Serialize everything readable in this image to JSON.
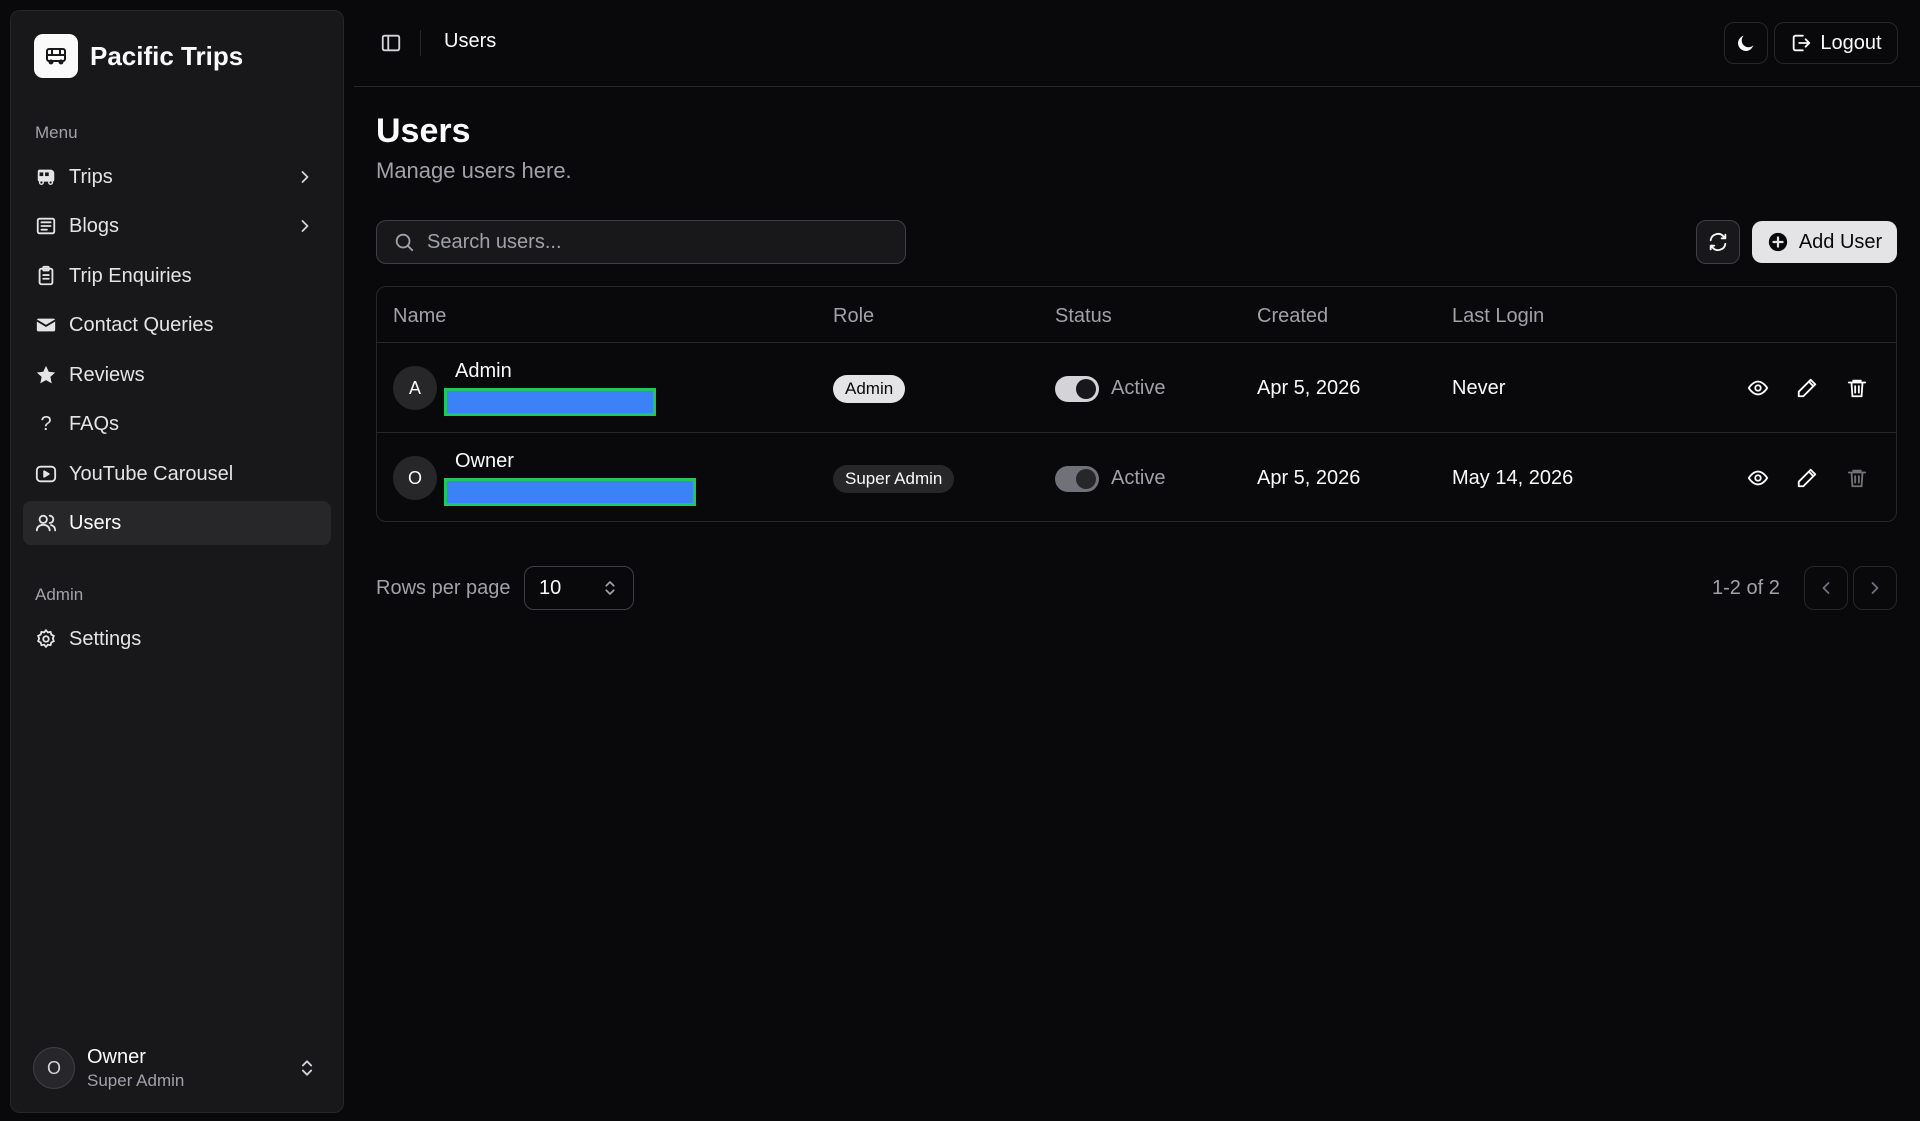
{
  "app": {
    "brand": "Pacific Trips"
  },
  "sidebar": {
    "menu_label": "Menu",
    "items": [
      {
        "label": "Trips",
        "icon": "bus-icon",
        "has_submenu": true
      },
      {
        "label": "Blogs",
        "icon": "newspaper-icon",
        "has_submenu": true
      },
      {
        "label": "Trip Enquiries",
        "icon": "clipboard-icon",
        "has_submenu": false
      },
      {
        "label": "Contact Queries",
        "icon": "mail-icon",
        "has_submenu": false
      },
      {
        "label": "Reviews",
        "icon": "star-icon",
        "has_submenu": false
      },
      {
        "label": "FAQs",
        "icon": "question-icon",
        "has_submenu": false
      },
      {
        "label": "YouTube Carousel",
        "icon": "youtube-icon",
        "has_submenu": false
      },
      {
        "label": "Users",
        "icon": "users-icon",
        "has_submenu": false,
        "active": true
      }
    ],
    "admin_label": "Admin",
    "admin_items": [
      {
        "label": "Settings",
        "icon": "gear-icon"
      }
    ],
    "footer": {
      "initial": "O",
      "name": "Owner",
      "role": "Super Admin"
    }
  },
  "header": {
    "breadcrumb": "Users",
    "logout_label": "Logout"
  },
  "page": {
    "title": "Users",
    "subtitle": "Manage users here."
  },
  "search": {
    "placeholder": "Search users...",
    "value": ""
  },
  "toolbar": {
    "add_label": "Add User"
  },
  "table": {
    "columns": [
      "Name",
      "Role",
      "Status",
      "Created",
      "Last Login"
    ],
    "rows": [
      {
        "initial": "A",
        "name": "Admin",
        "role": "Admin",
        "status": "Active",
        "created": "Apr 5, 2026",
        "last_login": "Never"
      },
      {
        "initial": "O",
        "name": "Owner",
        "role": "Super Admin",
        "status": "Active",
        "created": "Apr 5, 2026",
        "last_login": "May 14, 2026"
      }
    ]
  },
  "pagination": {
    "rows_label": "Rows per page",
    "rows_value": "10",
    "range": "1-2 of 2"
  },
  "colors": {
    "background": "#09090b",
    "sidebar": "#18181b",
    "border": "#27272a",
    "redaction_fill": "#3b82f6",
    "redaction_border": "#22c55e"
  }
}
